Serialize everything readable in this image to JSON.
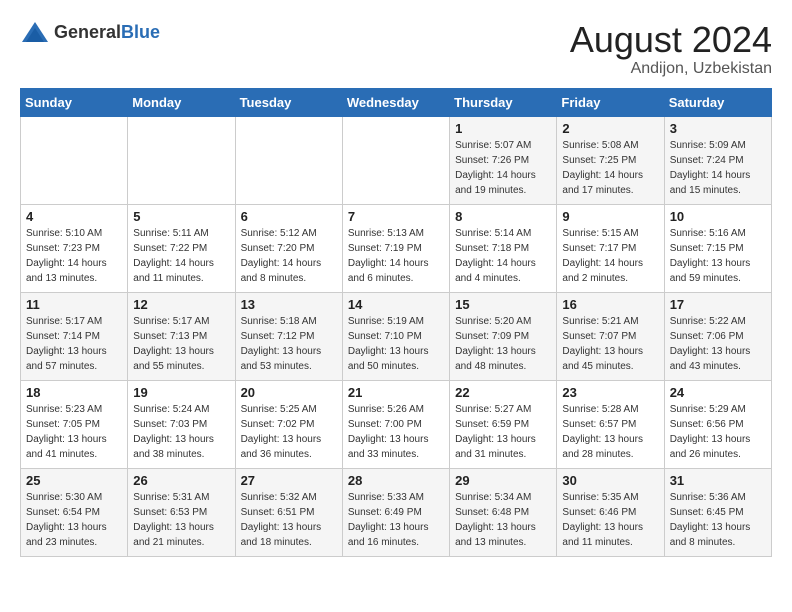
{
  "logo": {
    "general": "General",
    "blue": "Blue"
  },
  "title": {
    "month_year": "August 2024",
    "location": "Andijon, Uzbekistan"
  },
  "headers": [
    "Sunday",
    "Monday",
    "Tuesday",
    "Wednesday",
    "Thursday",
    "Friday",
    "Saturday"
  ],
  "weeks": [
    [
      {
        "day": "",
        "sunrise": "",
        "sunset": "",
        "daylight": ""
      },
      {
        "day": "",
        "sunrise": "",
        "sunset": "",
        "daylight": ""
      },
      {
        "day": "",
        "sunrise": "",
        "sunset": "",
        "daylight": ""
      },
      {
        "day": "",
        "sunrise": "",
        "sunset": "",
        "daylight": ""
      },
      {
        "day": "1",
        "sunrise": "Sunrise: 5:07 AM",
        "sunset": "Sunset: 7:26 PM",
        "daylight": "Daylight: 14 hours and 19 minutes."
      },
      {
        "day": "2",
        "sunrise": "Sunrise: 5:08 AM",
        "sunset": "Sunset: 7:25 PM",
        "daylight": "Daylight: 14 hours and 17 minutes."
      },
      {
        "day": "3",
        "sunrise": "Sunrise: 5:09 AM",
        "sunset": "Sunset: 7:24 PM",
        "daylight": "Daylight: 14 hours and 15 minutes."
      }
    ],
    [
      {
        "day": "4",
        "sunrise": "Sunrise: 5:10 AM",
        "sunset": "Sunset: 7:23 PM",
        "daylight": "Daylight: 14 hours and 13 minutes."
      },
      {
        "day": "5",
        "sunrise": "Sunrise: 5:11 AM",
        "sunset": "Sunset: 7:22 PM",
        "daylight": "Daylight: 14 hours and 11 minutes."
      },
      {
        "day": "6",
        "sunrise": "Sunrise: 5:12 AM",
        "sunset": "Sunset: 7:20 PM",
        "daylight": "Daylight: 14 hours and 8 minutes."
      },
      {
        "day": "7",
        "sunrise": "Sunrise: 5:13 AM",
        "sunset": "Sunset: 7:19 PM",
        "daylight": "Daylight: 14 hours and 6 minutes."
      },
      {
        "day": "8",
        "sunrise": "Sunrise: 5:14 AM",
        "sunset": "Sunset: 7:18 PM",
        "daylight": "Daylight: 14 hours and 4 minutes."
      },
      {
        "day": "9",
        "sunrise": "Sunrise: 5:15 AM",
        "sunset": "Sunset: 7:17 PM",
        "daylight": "Daylight: 14 hours and 2 minutes."
      },
      {
        "day": "10",
        "sunrise": "Sunrise: 5:16 AM",
        "sunset": "Sunset: 7:15 PM",
        "daylight": "Daylight: 13 hours and 59 minutes."
      }
    ],
    [
      {
        "day": "11",
        "sunrise": "Sunrise: 5:17 AM",
        "sunset": "Sunset: 7:14 PM",
        "daylight": "Daylight: 13 hours and 57 minutes."
      },
      {
        "day": "12",
        "sunrise": "Sunrise: 5:17 AM",
        "sunset": "Sunset: 7:13 PM",
        "daylight": "Daylight: 13 hours and 55 minutes."
      },
      {
        "day": "13",
        "sunrise": "Sunrise: 5:18 AM",
        "sunset": "Sunset: 7:12 PM",
        "daylight": "Daylight: 13 hours and 53 minutes."
      },
      {
        "day": "14",
        "sunrise": "Sunrise: 5:19 AM",
        "sunset": "Sunset: 7:10 PM",
        "daylight": "Daylight: 13 hours and 50 minutes."
      },
      {
        "day": "15",
        "sunrise": "Sunrise: 5:20 AM",
        "sunset": "Sunset: 7:09 PM",
        "daylight": "Daylight: 13 hours and 48 minutes."
      },
      {
        "day": "16",
        "sunrise": "Sunrise: 5:21 AM",
        "sunset": "Sunset: 7:07 PM",
        "daylight": "Daylight: 13 hours and 45 minutes."
      },
      {
        "day": "17",
        "sunrise": "Sunrise: 5:22 AM",
        "sunset": "Sunset: 7:06 PM",
        "daylight": "Daylight: 13 hours and 43 minutes."
      }
    ],
    [
      {
        "day": "18",
        "sunrise": "Sunrise: 5:23 AM",
        "sunset": "Sunset: 7:05 PM",
        "daylight": "Daylight: 13 hours and 41 minutes."
      },
      {
        "day": "19",
        "sunrise": "Sunrise: 5:24 AM",
        "sunset": "Sunset: 7:03 PM",
        "daylight": "Daylight: 13 hours and 38 minutes."
      },
      {
        "day": "20",
        "sunrise": "Sunrise: 5:25 AM",
        "sunset": "Sunset: 7:02 PM",
        "daylight": "Daylight: 13 hours and 36 minutes."
      },
      {
        "day": "21",
        "sunrise": "Sunrise: 5:26 AM",
        "sunset": "Sunset: 7:00 PM",
        "daylight": "Daylight: 13 hours and 33 minutes."
      },
      {
        "day": "22",
        "sunrise": "Sunrise: 5:27 AM",
        "sunset": "Sunset: 6:59 PM",
        "daylight": "Daylight: 13 hours and 31 minutes."
      },
      {
        "day": "23",
        "sunrise": "Sunrise: 5:28 AM",
        "sunset": "Sunset: 6:57 PM",
        "daylight": "Daylight: 13 hours and 28 minutes."
      },
      {
        "day": "24",
        "sunrise": "Sunrise: 5:29 AM",
        "sunset": "Sunset: 6:56 PM",
        "daylight": "Daylight: 13 hours and 26 minutes."
      }
    ],
    [
      {
        "day": "25",
        "sunrise": "Sunrise: 5:30 AM",
        "sunset": "Sunset: 6:54 PM",
        "daylight": "Daylight: 13 hours and 23 minutes."
      },
      {
        "day": "26",
        "sunrise": "Sunrise: 5:31 AM",
        "sunset": "Sunset: 6:53 PM",
        "daylight": "Daylight: 13 hours and 21 minutes."
      },
      {
        "day": "27",
        "sunrise": "Sunrise: 5:32 AM",
        "sunset": "Sunset: 6:51 PM",
        "daylight": "Daylight: 13 hours and 18 minutes."
      },
      {
        "day": "28",
        "sunrise": "Sunrise: 5:33 AM",
        "sunset": "Sunset: 6:49 PM",
        "daylight": "Daylight: 13 hours and 16 minutes."
      },
      {
        "day": "29",
        "sunrise": "Sunrise: 5:34 AM",
        "sunset": "Sunset: 6:48 PM",
        "daylight": "Daylight: 13 hours and 13 minutes."
      },
      {
        "day": "30",
        "sunrise": "Sunrise: 5:35 AM",
        "sunset": "Sunset: 6:46 PM",
        "daylight": "Daylight: 13 hours and 11 minutes."
      },
      {
        "day": "31",
        "sunrise": "Sunrise: 5:36 AM",
        "sunset": "Sunset: 6:45 PM",
        "daylight": "Daylight: 13 hours and 8 minutes."
      }
    ]
  ]
}
